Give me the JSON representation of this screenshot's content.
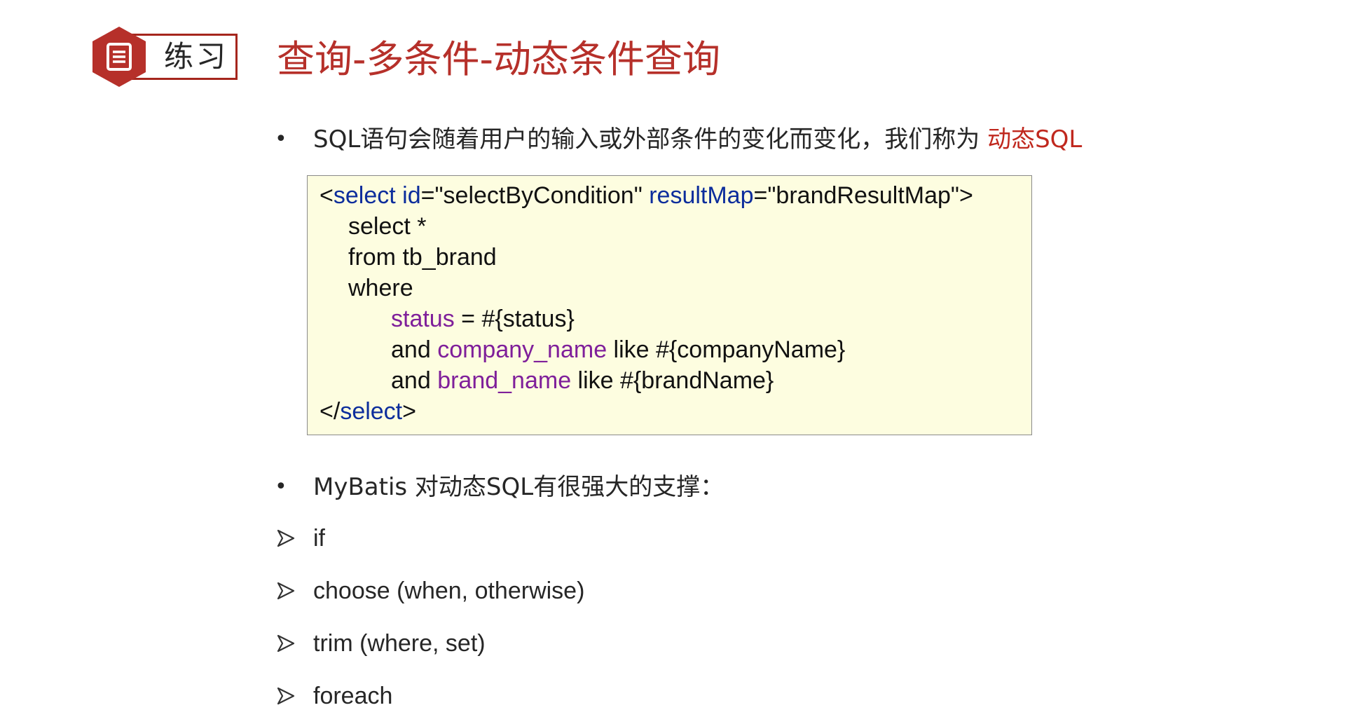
{
  "header": {
    "badge_label": "练习",
    "badge_icon": "document-icon",
    "title": "查询-多条件-动态条件查询"
  },
  "bullets": [
    {
      "text": "SQL语句会随着用户的输入或外部条件的变化而变化，我们称为 ",
      "highlight": "动态SQL"
    },
    {
      "text": "MyBatis 对动态SQL有很强大的支撑："
    }
  ],
  "code": {
    "line1": {
      "open": "<",
      "tag": "select",
      "attr1": " id",
      "eq1": "=",
      "val1": "\"selectByCondition\"",
      "attr2": " resultMap",
      "eq2": "=",
      "val2": "\"brandResultMap\"",
      "close": ">"
    },
    "line2": "select *",
    "line3": "from tb_brand",
    "line4": "where",
    "line5": {
      "col": "status",
      "rest": " = #{status}"
    },
    "line6": {
      "pre": "and ",
      "col": "company_name",
      "rest": " like #{companyName}"
    },
    "line7": {
      "pre": "and ",
      "col": "brand_name",
      "rest": " like #{brandName}"
    },
    "line8": {
      "open": "</",
      "tag": "select",
      "close": ">"
    }
  },
  "sub_items": [
    "if",
    "choose (when, otherwise)",
    "trim (where, set)",
    "foreach"
  ],
  "colors": {
    "accent": "#b6302a",
    "code_bg": "#fdfde0",
    "code_tag": "#0c2d9c",
    "code_column": "#7f1f9a"
  }
}
